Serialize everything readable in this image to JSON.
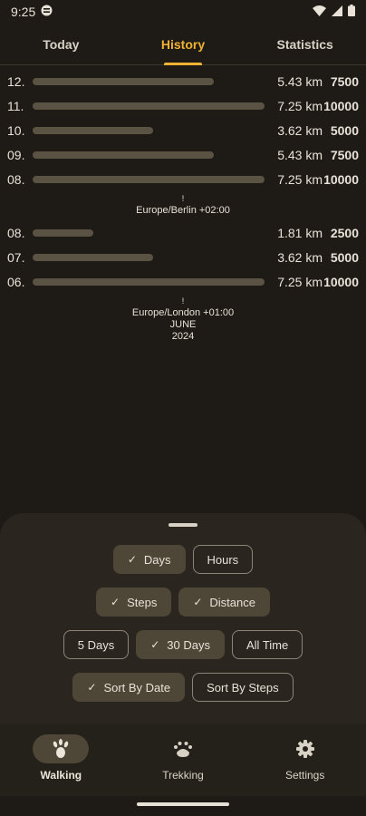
{
  "status_bar": {
    "time": "9:25"
  },
  "tabs": [
    {
      "label": "Today",
      "active": false
    },
    {
      "label": "History",
      "active": true
    },
    {
      "label": "Statistics",
      "active": false
    }
  ],
  "history": {
    "group1": [
      {
        "day": "12.",
        "km": "5.43 km",
        "steps": "7500",
        "fraction": 0.78
      },
      {
        "day": "11.",
        "km": "7.25 km",
        "steps": "10000",
        "fraction": 1.0
      },
      {
        "day": "10.",
        "km": "3.62 km",
        "steps": "5000",
        "fraction": 0.52
      },
      {
        "day": "09.",
        "km": "5.43 km",
        "steps": "7500",
        "fraction": 0.78
      },
      {
        "day": "08.",
        "km": "7.25 km",
        "steps": "10000",
        "fraction": 1.0
      }
    ],
    "marker1": {
      "tick": "!",
      "line1": "Europe/Berlin +02:00"
    },
    "group2": [
      {
        "day": "08.",
        "km": "1.81 km",
        "steps": "2500",
        "fraction": 0.26
      },
      {
        "day": "07.",
        "km": "3.62 km",
        "steps": "5000",
        "fraction": 0.52
      },
      {
        "day": "06.",
        "km": "7.25 km",
        "steps": "10000",
        "fraction": 1.0
      }
    ],
    "marker2": {
      "tick": "!",
      "line1": "Europe/London +01:00",
      "line2": "JUNE",
      "line3": "2024"
    }
  },
  "filters": {
    "check": "✓",
    "row1": [
      {
        "label": "Days",
        "selected": true
      },
      {
        "label": "Hours",
        "selected": false
      }
    ],
    "row2": [
      {
        "label": "Steps",
        "selected": true
      },
      {
        "label": "Distance",
        "selected": true
      }
    ],
    "row3": [
      {
        "label": "5 Days",
        "selected": false
      },
      {
        "label": "30 Days",
        "selected": true
      },
      {
        "label": "All Time",
        "selected": false
      }
    ],
    "row4": [
      {
        "label": "Sort By Date",
        "selected": true
      },
      {
        "label": "Sort By Steps",
        "selected": false
      }
    ]
  },
  "nav": [
    {
      "label": "Walking",
      "icon": "footprint-icon",
      "active": true
    },
    {
      "label": "Trekking",
      "icon": "paw-icon",
      "active": false
    },
    {
      "label": "Settings",
      "icon": "gear-icon",
      "active": false
    }
  ],
  "colors": {
    "accent": "#f0b232",
    "bar": "#5a5243",
    "chip_selected": "#4e4636"
  }
}
